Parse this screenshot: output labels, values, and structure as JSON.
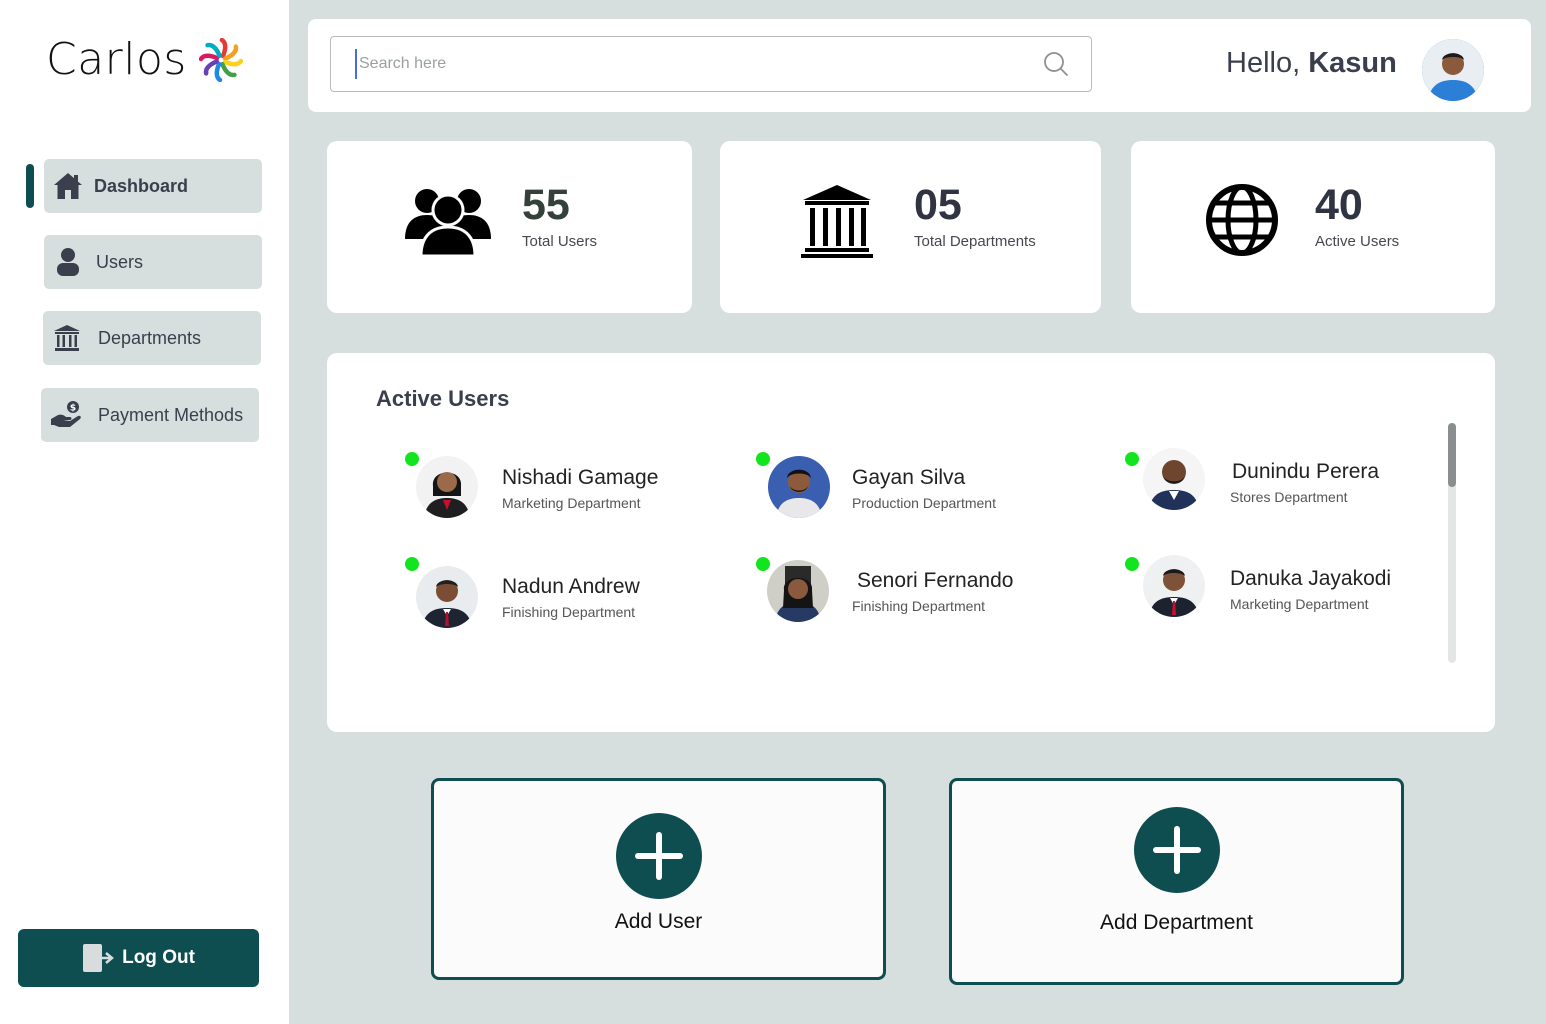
{
  "brand": {
    "name": "Carlos",
    "petal_colors": [
      "#e53935",
      "#f4a11c",
      "#fbd21a",
      "#43a047",
      "#1e88e5",
      "#6a3fb5",
      "#d81b60",
      "#00acc1"
    ]
  },
  "colors": {
    "accent": "#0e4d50",
    "background": "#d6dfde",
    "online": "#12e41e"
  },
  "sidebar": {
    "items": [
      {
        "label": "Dashboard",
        "icon": "home-icon",
        "active": true
      },
      {
        "label": "Users",
        "icon": "user-icon",
        "active": false
      },
      {
        "label": "Departments",
        "icon": "bank-icon",
        "active": false
      },
      {
        "label": "Payment Methods",
        "icon": "hand-money-icon",
        "active": false
      }
    ],
    "logout_label": "Log Out"
  },
  "header": {
    "search_placeholder": "Search here",
    "greeting": "Hello,",
    "user_name": "Kasun"
  },
  "stats": [
    {
      "value": "55",
      "label": "Total Users",
      "icon": "users-group-icon"
    },
    {
      "value": "05",
      "label": "Total Departments",
      "icon": "institution-icon"
    },
    {
      "value": "40",
      "label": "Active Users",
      "icon": "globe-icon"
    }
  ],
  "active_users": {
    "title": "Active Users",
    "users": [
      {
        "name": "Nishadi Gamage",
        "department": "Marketing Department",
        "online": true
      },
      {
        "name": "Gayan Silva",
        "department": "Production Department",
        "online": true
      },
      {
        "name": "Dunindu Perera",
        "department": "Stores Department",
        "online": true
      },
      {
        "name": "Nadun Andrew",
        "department": "Finishing Department",
        "online": true
      },
      {
        "name": "Senori Fernando",
        "department": "Finishing Department",
        "online": true
      },
      {
        "name": "Danuka Jayakodi",
        "department": "Marketing Department",
        "online": true
      }
    ]
  },
  "actions": [
    {
      "label": "Add User",
      "icon": "plus-icon"
    },
    {
      "label": "Add Department",
      "icon": "plus-icon"
    }
  ]
}
